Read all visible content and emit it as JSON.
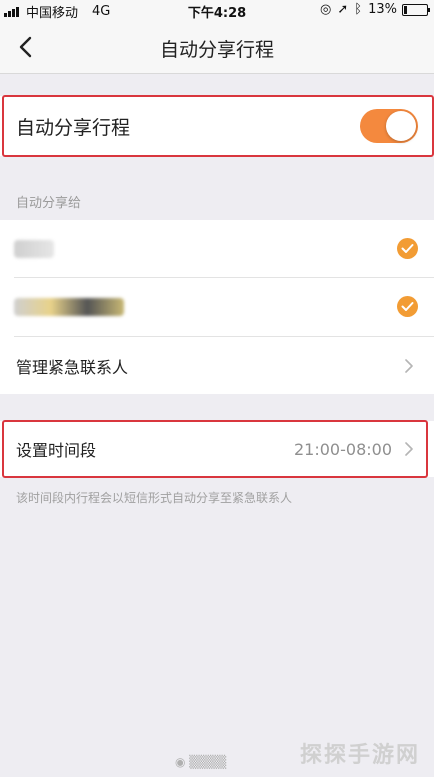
{
  "status_bar": {
    "carrier": "中国移动",
    "network": "4G",
    "time": "下午4:28",
    "battery": "13%",
    "battery_level": 0.13
  },
  "nav": {
    "back_icon": "chevron-left-icon",
    "title": "自动分享行程"
  },
  "auto_share": {
    "label": "自动分享行程",
    "enabled": true,
    "toggle_color": "#f4893e"
  },
  "share_to": {
    "section_label": "自动分享给",
    "contacts": [
      {
        "checked": true
      },
      {
        "checked": true
      }
    ],
    "manage_label": "管理紧急联系人"
  },
  "time_period": {
    "label": "设置时间段",
    "value": "21:00-08:00",
    "note": "该时间段内行程会以短信形式自动分享至紧急联系人"
  },
  "watermark": "探探手游网",
  "colors": {
    "accent": "#f4893e",
    "highlight": "#d9363e",
    "background": "#eeedf2"
  }
}
